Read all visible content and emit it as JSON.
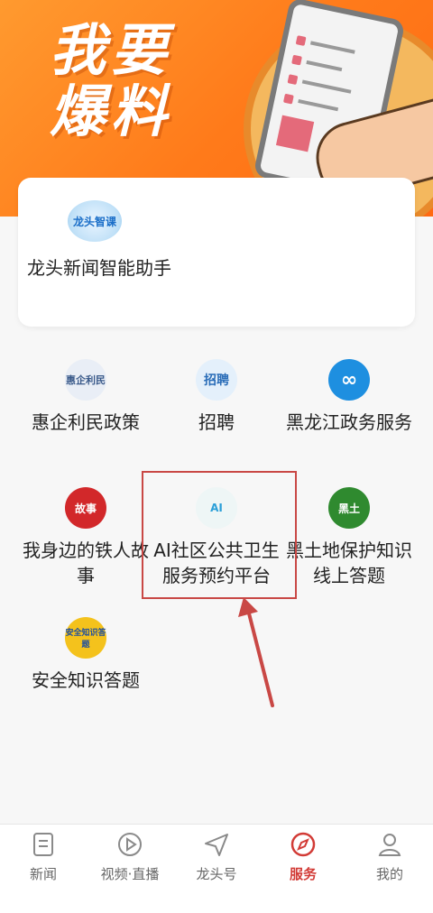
{
  "banner": {
    "line1": "我要",
    "line2": "爆料"
  },
  "assistant": {
    "icon_text": "龙头智课",
    "label": "龙头新闻智能助手"
  },
  "services": [
    {
      "icon_text": "惠企利民",
      "label": "惠企利民政策"
    },
    {
      "icon_text": "招聘",
      "label": "招聘"
    },
    {
      "icon_text": "∞",
      "label": "黑龙江政务服务"
    },
    {
      "icon_text": "故事",
      "label": "我身边的铁人故事"
    },
    {
      "icon_text": "AI",
      "label": "AI社区公共卫生服务预约平台"
    },
    {
      "icon_text": "黑土",
      "label": "黑土地保护知识线上答题"
    },
    {
      "icon_text": "安全知识答题",
      "label": "安全知识答题"
    }
  ],
  "tabs": [
    {
      "label": "新闻",
      "icon": "news-icon"
    },
    {
      "label": "视频·直播",
      "icon": "play-icon"
    },
    {
      "label": "龙头号",
      "icon": "send-icon"
    },
    {
      "label": "服务",
      "icon": "service-icon",
      "active": true
    },
    {
      "label": "我的",
      "icon": "profile-icon"
    }
  ],
  "colors": {
    "accent": "#d23b36",
    "banner": "#ff7a1a"
  }
}
